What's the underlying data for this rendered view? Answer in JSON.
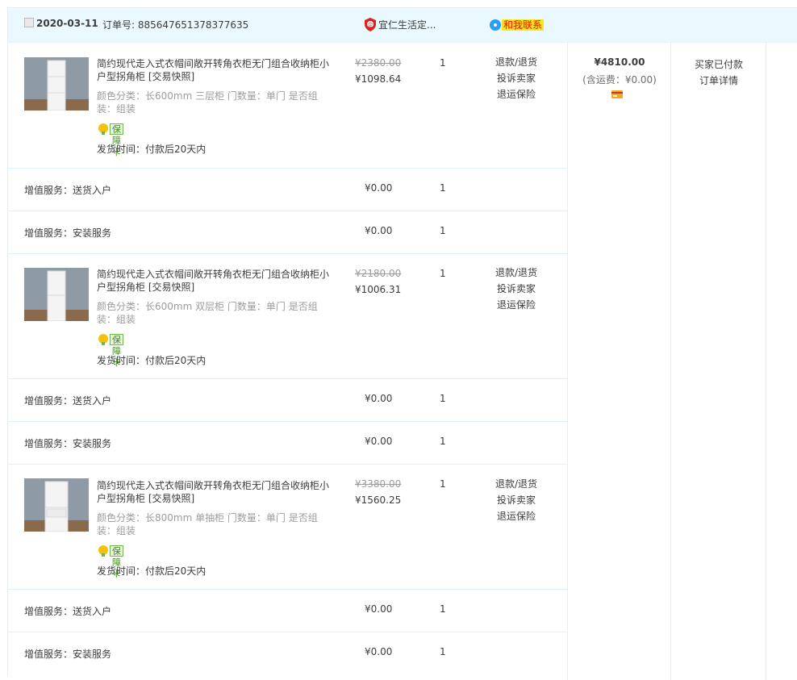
{
  "order": {
    "date": "2020-03-11",
    "order_no_label": "订单号: 885647651378377635",
    "shop_name": "宜仁生活定...",
    "chat_label": "和我联系",
    "total": "¥4810.00",
    "shipping_note": "(含运费：¥0.00)",
    "status_paid": "买家已付款",
    "detail_link": "订单详情"
  },
  "items": [
    {
      "title": "简约现代走入式衣帽间敞开转角衣柜无门组合收纳柜小户型拐角柜 [交易快照]",
      "attr": "颜色分类：长600mm 三层柜  门数量：单门  是否组装：组装",
      "badge": "保障卡",
      "ship": "发货时间：付款后20天内",
      "orig_price": "¥2380.00",
      "price": "¥1098.64",
      "qty": "1",
      "op_refund": "退款/退货",
      "op_complain": "投诉卖家",
      "op_insurance": "退运保险",
      "services": [
        {
          "label": "增值服务：送货入户",
          "price": "¥0.00",
          "qty": "1"
        },
        {
          "label": "增值服务：安装服务",
          "price": "¥0.00",
          "qty": "1"
        }
      ]
    },
    {
      "title": "简约现代走入式衣帽间敞开转角衣柜无门组合收纳柜小户型拐角柜 [交易快照]",
      "attr": "颜色分类：长600mm 双层柜  门数量：单门  是否组装：组装",
      "badge": "保障卡",
      "ship": "发货时间：付款后20天内",
      "orig_price": "¥2180.00",
      "price": "¥1006.31",
      "qty": "1",
      "op_refund": "退款/退货",
      "op_complain": "投诉卖家",
      "op_insurance": "退运保险",
      "services": [
        {
          "label": "增值服务：送货入户",
          "price": "¥0.00",
          "qty": "1"
        },
        {
          "label": "增值服务：安装服务",
          "price": "¥0.00",
          "qty": "1"
        }
      ]
    },
    {
      "title": "简约现代走入式衣帽间敞开转角衣柜无门组合收纳柜小户型拐角柜 [交易快照]",
      "attr": "颜色分类：长800mm 单抽柜  门数量：单门  是否组装：组装",
      "badge": "保障卡",
      "ship": "发货时间：付款后20天内",
      "orig_price": "¥3380.00",
      "price": "¥1560.25",
      "qty": "1",
      "op_refund": "退款/退货",
      "op_complain": "投诉卖家",
      "op_insurance": "退运保险",
      "services": [
        {
          "label": "增值服务：送货入户",
          "price": "¥0.00",
          "qty": "1"
        },
        {
          "label": "增值服务：安装服务",
          "price": "¥0.00",
          "qty": "1"
        }
      ]
    }
  ],
  "colors": {
    "header_bg": "#eaf8ff",
    "border": "#daf3ff",
    "chat_bg": "#f8e71c",
    "chat_text": "#ff0000",
    "muted": "#9c9c9c"
  },
  "icons": {
    "shop": "shop-badge-icon",
    "chat": "chat-bubble-icon",
    "guarantee": "guarantee-card-icon",
    "payment": "credit-card-icon"
  }
}
